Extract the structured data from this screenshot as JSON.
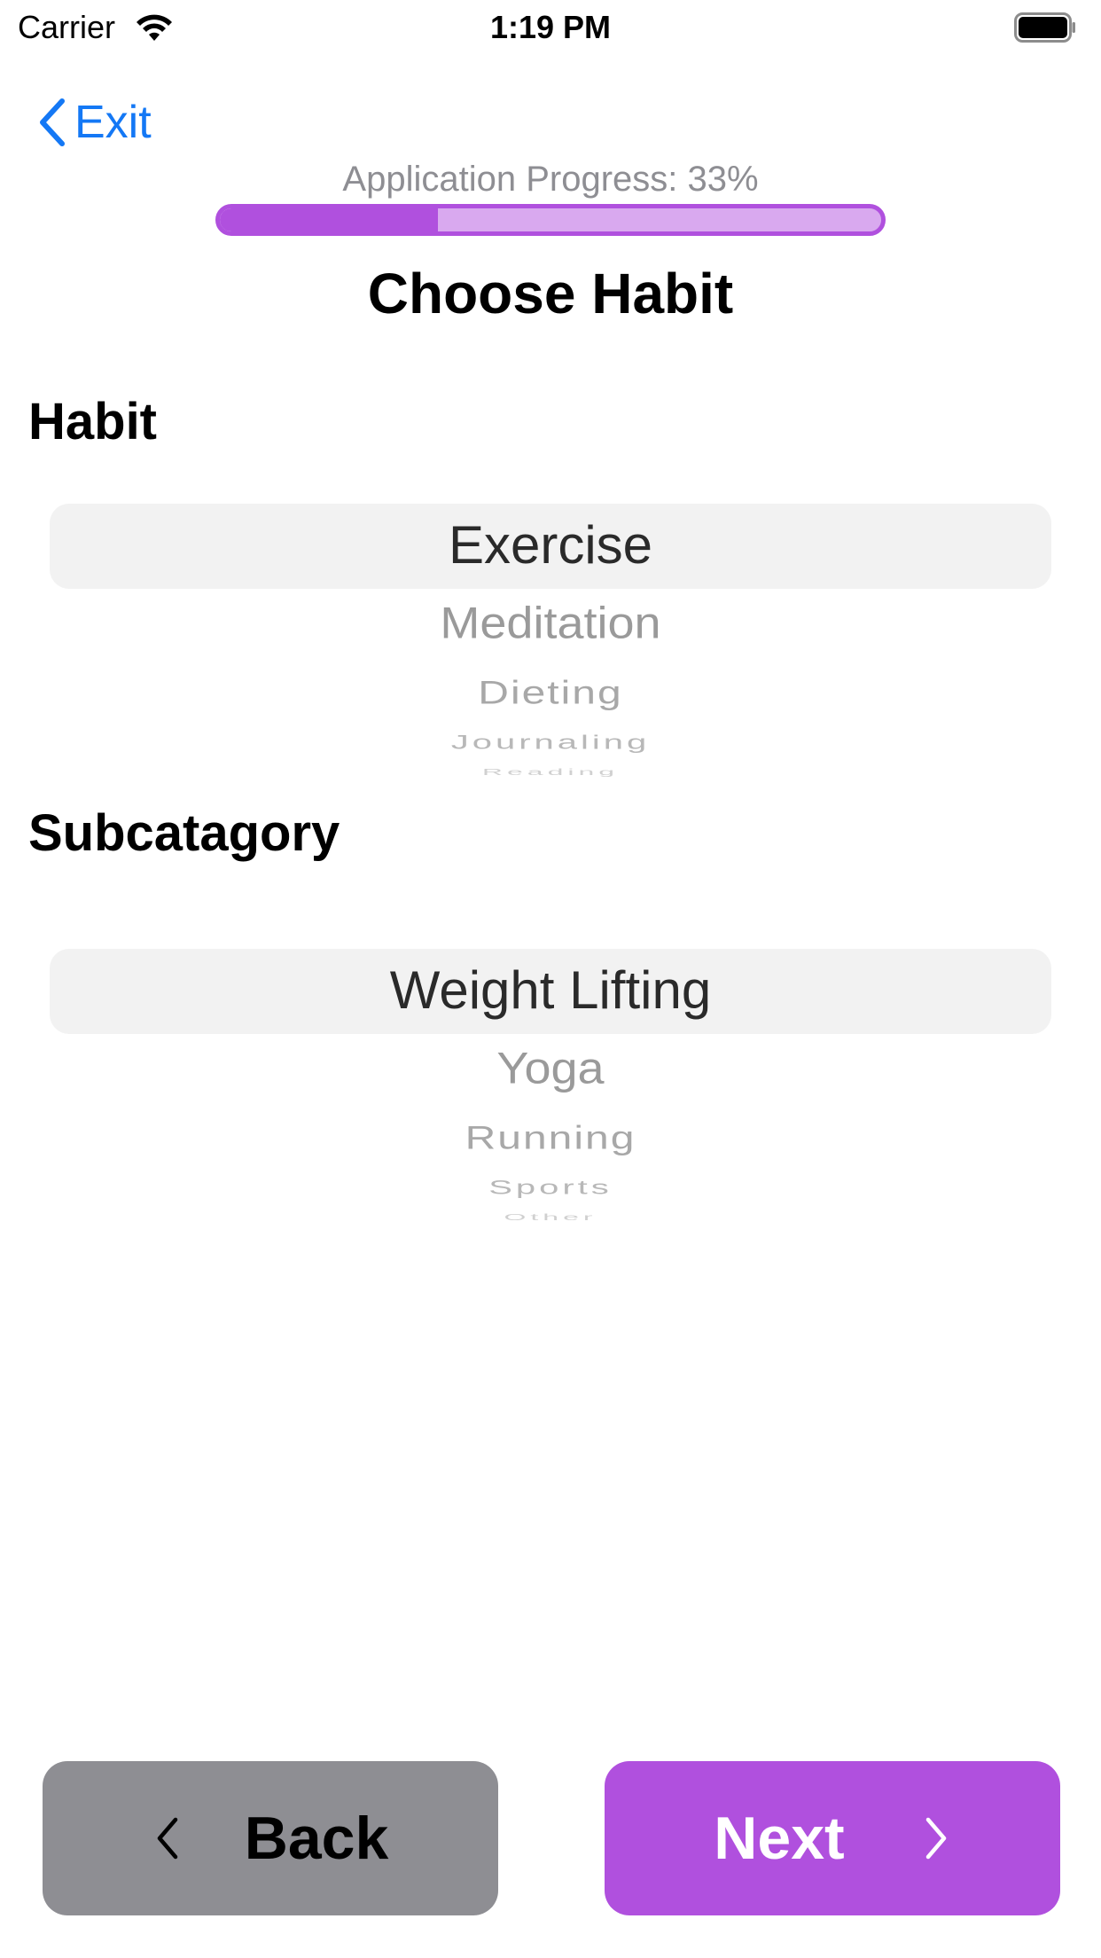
{
  "status_bar": {
    "carrier": "Carrier",
    "time": "1:19 PM"
  },
  "nav": {
    "exit_label": "Exit"
  },
  "progress": {
    "label": "Application Progress: 33%",
    "percent": 33
  },
  "page": {
    "title": "Choose Habit"
  },
  "habit": {
    "label": "Habit",
    "options": [
      "Exercise",
      "Meditation",
      "Dieting",
      "Journaling",
      "Reading"
    ],
    "selected": "Exercise"
  },
  "subcategory": {
    "label": "Subcatagory",
    "options": [
      "Weight Lifting",
      "Yoga",
      "Running",
      "Sports",
      "Other"
    ],
    "selected": "Weight Lifting"
  },
  "buttons": {
    "back_label": "Back",
    "next_label": "Next"
  },
  "colors": {
    "accent": "#b050de",
    "accent_light": "#d9a9ef",
    "link_blue": "#1478f5",
    "back_button_gray": "#8e8e93"
  }
}
